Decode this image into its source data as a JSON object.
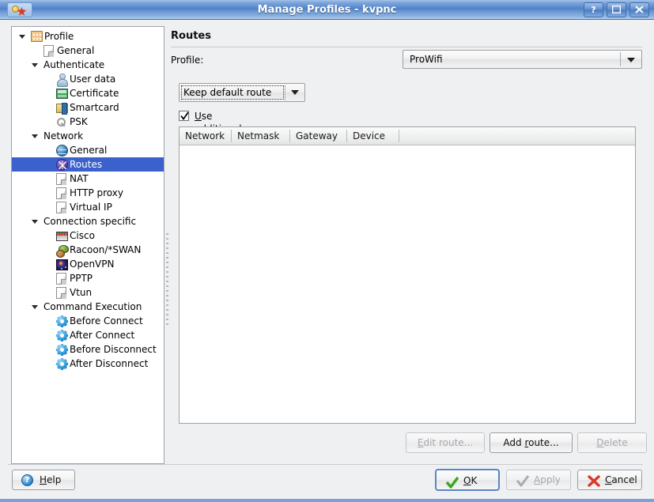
{
  "window": {
    "title": "Manage Profiles - kvpnc",
    "app_icon": "kvpnc-icon",
    "buttons": {
      "help": "?",
      "maximize": "maximize-icon",
      "close": "close-icon"
    }
  },
  "sidebar": {
    "items": [
      {
        "label": "Profile",
        "indent": 0,
        "icon": "profile-icon",
        "twisty": true,
        "selected": false
      },
      {
        "label": "General",
        "indent": 1,
        "icon": "document-icon",
        "twisty": false,
        "selected": false
      },
      {
        "label": "Authenticate",
        "indent": 1,
        "icon": "none",
        "twisty": true,
        "selected": false
      },
      {
        "label": "User data",
        "indent": 2,
        "icon": "user-icon",
        "twisty": false,
        "selected": false
      },
      {
        "label": "Certificate",
        "indent": 2,
        "icon": "certificate-icon",
        "twisty": false,
        "selected": false
      },
      {
        "label": "Smartcard",
        "indent": 2,
        "icon": "smartcard-icon",
        "twisty": false,
        "selected": false
      },
      {
        "label": "PSK",
        "indent": 2,
        "icon": "key-icon",
        "twisty": false,
        "selected": false
      },
      {
        "label": "Network",
        "indent": 1,
        "icon": "none",
        "twisty": true,
        "selected": false
      },
      {
        "label": "General",
        "indent": 2,
        "icon": "globe-icon",
        "twisty": false,
        "selected": false
      },
      {
        "label": "Routes",
        "indent": 2,
        "icon": "routes-icon",
        "twisty": false,
        "selected": true
      },
      {
        "label": "NAT",
        "indent": 2,
        "icon": "document-icon",
        "twisty": false,
        "selected": false
      },
      {
        "label": "HTTP proxy",
        "indent": 2,
        "icon": "document-icon",
        "twisty": false,
        "selected": false
      },
      {
        "label": "Virtual IP",
        "indent": 2,
        "icon": "document-icon",
        "twisty": false,
        "selected": false
      },
      {
        "label": "Connection specific",
        "indent": 1,
        "icon": "none",
        "twisty": true,
        "selected": false
      },
      {
        "label": "Cisco",
        "indent": 2,
        "icon": "cisco-icon",
        "twisty": false,
        "selected": false
      },
      {
        "label": "Racoon/*SWAN",
        "indent": 2,
        "icon": "racoon-icon",
        "twisty": false,
        "selected": false
      },
      {
        "label": "OpenVPN",
        "indent": 2,
        "icon": "openvpn-icon",
        "twisty": false,
        "selected": false
      },
      {
        "label": "PPTP",
        "indent": 2,
        "icon": "document-icon",
        "twisty": false,
        "selected": false
      },
      {
        "label": "Vtun",
        "indent": 2,
        "icon": "document-icon",
        "twisty": false,
        "selected": false
      },
      {
        "label": "Command Execution",
        "indent": 1,
        "icon": "none",
        "twisty": true,
        "selected": false
      },
      {
        "label": "Before Connect",
        "indent": 2,
        "icon": "gear-icon",
        "twisty": false,
        "selected": false
      },
      {
        "label": "After Connect",
        "indent": 2,
        "icon": "gear-icon",
        "twisty": false,
        "selected": false
      },
      {
        "label": "Before Disconnect",
        "indent": 2,
        "icon": "gear-icon",
        "twisty": false,
        "selected": false
      },
      {
        "label": "After Disconnect",
        "indent": 2,
        "icon": "gear-icon",
        "twisty": false,
        "selected": false
      }
    ]
  },
  "main": {
    "page_title": "Routes",
    "profile_label": "Profile:",
    "profile_value": "ProWifi",
    "route_mode_value": "Keep default route",
    "checkbox": {
      "label_accel": "U",
      "label_rest": "se additional network routes",
      "checked": true
    },
    "table": {
      "columns": [
        "Network",
        "Netmask",
        "Gateway",
        "Device"
      ],
      "rows": []
    },
    "actions": {
      "edit_route": "Edit route...",
      "edit_route_accel": "E",
      "edit_route_rest": "dit route...",
      "add_route_pre": "Add ",
      "add_route_accel": "r",
      "add_route_rest": "oute...",
      "delete": "Delete",
      "delete_accel": "D",
      "delete_rest": "elete"
    }
  },
  "footer": {
    "help_accel": "H",
    "help_rest": "elp",
    "ok_accel": "O",
    "ok_rest": "K",
    "apply_accel": "A",
    "apply_rest": "pply",
    "cancel_accel": "C",
    "cancel_rest": "ancel"
  },
  "colors": {
    "selection": "#3b62cc",
    "titlebar": "#4e80c8",
    "window_border": "#7ba2d8",
    "dialog_bg": "#eff0f1",
    "ok_green": "#3aa61e",
    "cancel_red": "#d9382a"
  }
}
